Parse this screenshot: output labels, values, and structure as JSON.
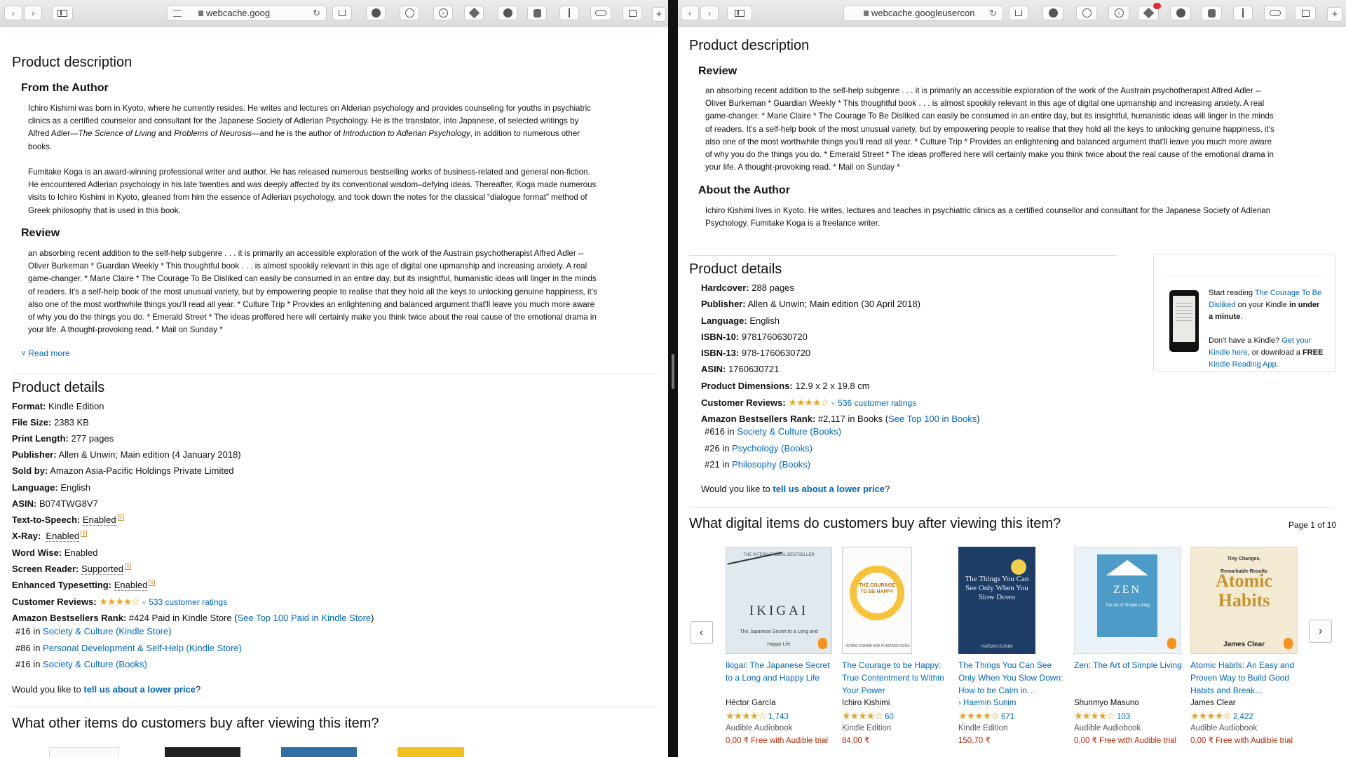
{
  "left": {
    "url": "webcache.goog",
    "product_description_heading": "Product description",
    "from_author_heading": "From the Author",
    "author_p1": [
      "Ichiro Kishimi was born in Kyoto, where he currently resides. He writes and lectures on Alderian psychology and provides counseling for youths in psychiatric",
      "clinics as a certified counselor and consultant for the Japanese Society of Adlerian Psychology. He is the translator, into Japanese, of selected writings by"
    ],
    "author_p1_tail": {
      "before": "Alfred Adler—",
      "italic1": "The Science of Living",
      "mid1": " and ",
      "italic2": "Problems of Neurosis",
      "mid2": "—and he is the author of ",
      "italic3": "Introduction to Adlerian Psychology",
      "after": ", in addition to numerous other",
      "last": "books."
    },
    "author_p2": [
      "Fumitake Koga is an award-winning professional writer and author. He has released numerous bestselling works of business-related and general non-fiction.",
      "He encountered Adlerian psychology in his late twenties and was deeply affected by its conventional wisdom–defying ideas. Thereafter, Koga made numerous",
      "visits to Ichiro Kishimi in Kyoto, gleaned from him the essence of Adlerian psychology, and took down the notes for the classical “dialogue format” method of",
      "Greek philosophy that is used in this book."
    ],
    "review_heading": "Review",
    "review_lines": [
      "an absorbing recent addition to the self-help subgenre . . . it is primarily an accessible exploration of the work of the Austrain psychotherapist Alfred Adler --",
      "Oliver Burkeman * Guardian Weekly * This thoughtful book . . . is almost spookily relevant in this age of digital one upmanship and increasing anxiety. A real",
      "game-changer. * Marie Claire * The Courage To Be Disliked can easily be consumed in an entire day, but its insightful, humanistic ideas will linger in the minds",
      "of readers. It's a self-help book of the most unusual variety, but by empowering people to realise that they hold all the keys to unlocking genuine happiness, it's",
      "also one of the most worthwhile things you'll read all year. * Culture Trip * Provides an enlightening and balanced argument that'll leave you much more aware",
      "of why you do the things you do. * Emerald Street * The ideas proffered here will certainly make you think twice about the real cause of the emotional drama in",
      "your life. A thought-provoking read. * Mail on Sunday *"
    ],
    "read_more": "Read more",
    "product_details_heading": "Product details",
    "details": [
      {
        "label": "Format:",
        "value": "Kindle Edition"
      },
      {
        "label": "File Size:",
        "value": "2383 KB"
      },
      {
        "label": "Print Length:",
        "value": "277 pages"
      },
      {
        "label": "Publisher:",
        "value": "Allen & Unwin; Main edition (4 January 2018)"
      },
      {
        "label": "Sold by:",
        "value": "Amazon Asia-Pacific Holdings Private Limited"
      },
      {
        "label": "Language:",
        "value": "English"
      },
      {
        "label": "ASIN:",
        "value": "B074TWG8V7"
      },
      {
        "label": "Text-to-Speech:",
        "value": "Enabled"
      },
      {
        "label": "X-Ray:",
        "value": "Enabled"
      },
      {
        "label": "Word Wise:",
        "value": "Enabled"
      },
      {
        "label": "Screen Reader:",
        "value": "Supported"
      },
      {
        "label": "Enhanced Typesetting:",
        "value": "Enabled"
      }
    ],
    "customer_reviews_label": "Customer Reviews:",
    "ratings_link": "533 customer ratings",
    "rank_label": "Amazon Bestsellers Rank:",
    "rank_value": "#424 Paid in Kindle Store (",
    "rank_link": "See Top 100 Paid in Kindle Store",
    "rank_close": ")",
    "sub_ranks": [
      {
        "rank": "#16 in",
        "category": "Society & Culture (Kindle Store)"
      },
      {
        "rank": "#86 in",
        "category": "Personal Development & Self-Help (Kindle Store)"
      },
      {
        "rank": "#16 in",
        "category": "Society & Culture (Books)"
      }
    ],
    "lower_price_prefix": "Would you like to ",
    "lower_price_link": "tell us about a lower price",
    "lower_price_suffix": "?",
    "other_items_heading": "What other items do customers buy after viewing this item?"
  },
  "right": {
    "url": "webcache.googleusercon",
    "product_description_heading": "Product description",
    "review_heading": "Review",
    "review_lines": [
      "an absorbing recent addition to the self-help subgenre . . . it is primarily an accessible exploration of the work of the Austrain psychotherapist Alfred Adler --",
      "Oliver Burkeman * Guardian Weekly * This thoughtful book . . . is almost spookily relevant in this age of digital one upmanship and increasing anxiety. A real",
      "game-changer. * Marie Claire * The Courage To Be Disliked can easily be consumed in an entire day, but its insightful, humanistic ideas will linger in the minds",
      "of readers. It's a self-help book of the most unusual variety, but by empowering people to realise that they hold all the keys to unlocking genuine happiness, it's",
      "also one of the most worthwhile things you'll read all year. * Culture Trip * Provides an enlightening and balanced argument that'll leave you much more aware",
      "of why you do the things you do. * Emerald Street * The ideas proffered here will certainly make you think twice about the real cause of the emotional drama in",
      "your life. A thought-provoking read. * Mail on Sunday *"
    ],
    "about_author_heading": "About the Author",
    "about_lines": [
      "Ichiro Kishimi lives in Kyoto. He writes, lectures and teaches in psychiatric clinics as a certified counsellor and consultant for the Japanese Society of Adlerian",
      "Psychology. Fumitake Koga is a freelance writer."
    ],
    "product_details_heading": "Product details",
    "details": [
      {
        "label": "Hardcover:",
        "value": "288 pages"
      },
      {
        "label": "Publisher:",
        "value": "Allen & Unwin; Main edition (30 April 2018)"
      },
      {
        "label": "Language:",
        "value": "English"
      },
      {
        "label": "ISBN-10:",
        "value": "9781760630720"
      },
      {
        "label": "ISBN-13:",
        "value": "978-1760630720"
      },
      {
        "label": "ASIN:",
        "value": "1760630721"
      },
      {
        "label": "Product Dimensions:",
        "value": "12.9 x 2 x 19.8 cm"
      }
    ],
    "customer_reviews_label": "Customer Reviews:",
    "ratings_link": "536 customer ratings",
    "rank_label": "Amazon Bestsellers Rank:",
    "rank_value": "#2,117 in Books (",
    "rank_link": "See Top 100 in Books",
    "rank_close": ")",
    "sub_ranks": [
      {
        "rank": "#616 in",
        "category": "Society & Culture (Books)"
      },
      {
        "rank": "#26 in",
        "category": "Psychology (Books)"
      },
      {
        "rank": "#21 in",
        "category": "Philosophy (Books)"
      }
    ],
    "lower_price_prefix": "Would you like to ",
    "lower_price_link": "tell us about a lower price",
    "lower_price_suffix": "?",
    "kindle": {
      "start_reading": "Start reading ",
      "book_link": "The Courage To Be Disliked",
      "on_kindle": " on your Kindle ",
      "in_minute": "in under a minute",
      "period": ".",
      "no_kindle": "Don't have a Kindle? ",
      "get_kindle": "Get your Kindle here",
      "or_download": ", or download a ",
      "free": "FREE",
      "reading_app": "Kindle Reading App",
      "end": "."
    },
    "carousel_heading": "What digital items do customers buy after viewing this item?",
    "page_indicator": "Page 1 of 10",
    "items": [
      {
        "title": "Ikigai: The Japanese Secret to a Long and Happy Life",
        "author": "Héctor García",
        "rating_count": "1,743",
        "format": "Audible Audiobook",
        "price": "0,00 ₹ Free with Audible trial",
        "cover_color": "#dfe9ee",
        "cover_title": "IKIGAI",
        "cover_sub": "The Japanese Secret to a Long and Happy Life"
      },
      {
        "title": "The Courage to be Happy: True Contentment Is Within Your Power",
        "author": "Ichiro Kishimi",
        "rating_count": "60",
        "format": "Kindle Edition",
        "price": "84,00 ₹",
        "cover_color": "#fbfbfb",
        "cover_title": "THE COURAGE TO BE HAPPY",
        "cover_sub": "ICHIRO KISHIMI AND FUMITAKE KOGA"
      },
      {
        "title": "The Things You Can See Only When You Slow Down: How to be Calm in…",
        "author": "› Haemin Sunim",
        "rating_count": "671",
        "format": "Kindle Edition",
        "price": "150,70 ₹",
        "cover_color": "#1e3d66",
        "cover_title": "The Things You Can See Only When You Slow Down",
        "cover_sub": "HAEMIN SUNIM"
      },
      {
        "title": "Zen: The Art of Simple Living",
        "author": "Shunmyo Masuno",
        "rating_count": "103",
        "format": "Audible Audiobook",
        "price": "0,00 ₹ Free with Audible trial",
        "cover_color": "#e9f2f6",
        "cover_title": "ZEN",
        "cover_sub": "The Art of Simple Living"
      },
      {
        "title": "Atomic Habits: An Easy and Proven Way to Build Good Habits and Break…",
        "author": "James Clear",
        "rating_count": "2,422",
        "format": "Audible Audiobook",
        "price": "0,00 ₹ Free with Audible trial",
        "cover_color": "#f3ead3",
        "cover_title": "Atomic Habits",
        "cover_sub": "James Clear"
      }
    ]
  },
  "icons": {
    "back": "‹",
    "forward": "›",
    "stars": "★★★★☆",
    "chev": "˅",
    "reload": "↻",
    "carousel_prev": "‹",
    "carousel_next": "›"
  }
}
